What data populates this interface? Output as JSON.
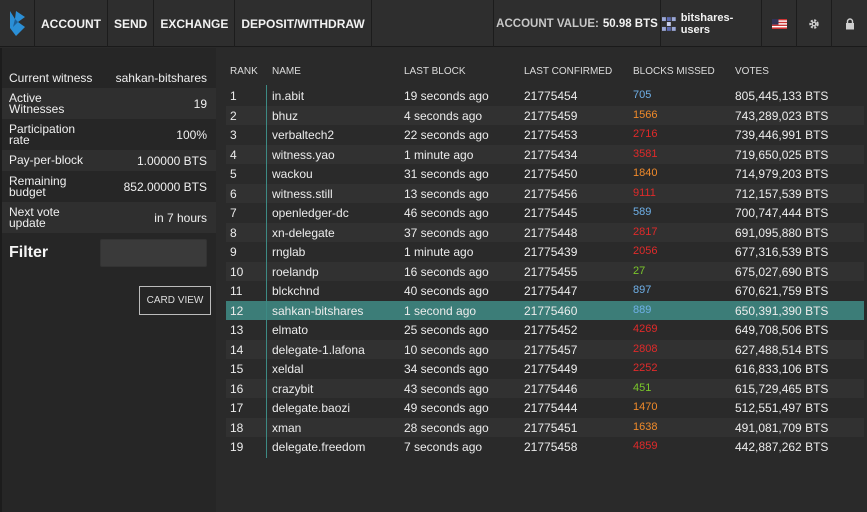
{
  "nav": {
    "items": [
      "ACCOUNT",
      "SEND",
      "EXCHANGE",
      "DEPOSIT/WITHDRAW"
    ],
    "account_value_label": "ACCOUNT VALUE:",
    "account_value": "50.98 BTS",
    "username": "bitshares-users"
  },
  "colors": {
    "accent": "#3c7d78",
    "brand": "#2b8fd6",
    "miss_blue": "#6fb0e8",
    "miss_orange": "#f08a2a",
    "miss_red": "#e02a2a",
    "miss_green": "#7ac72a"
  },
  "info": {
    "current_witness_label": "Current witness",
    "current_witness": "sahkan-bitshares",
    "active_witnesses_label": "Active Witnesses",
    "active_witnesses": "19",
    "participation_label": "Participation rate",
    "participation": "100%",
    "pay_per_block_label": "Pay-per-block",
    "pay_per_block": "1.00000 BTS",
    "remaining_budget_label": "Remaining budget",
    "remaining_budget": "852.00000 BTS",
    "next_vote_label": "Next vote update",
    "next_vote": "in 7 hours"
  },
  "filter": {
    "label": "Filter",
    "value": ""
  },
  "card_view_label": "CARD VIEW",
  "table": {
    "headers": [
      "RANK",
      "NAME",
      "LAST BLOCK",
      "LAST CONFIRMED",
      "BLOCKS MISSED",
      "VOTES"
    ],
    "rows": [
      {
        "rank": "1",
        "name": "in.abit",
        "last_block": "19 seconds ago",
        "confirmed": "21775454",
        "missed": "705",
        "missed_color": "#6fb0e8",
        "votes": "805,445,133 BTS"
      },
      {
        "rank": "2",
        "name": "bhuz",
        "last_block": "4 seconds ago",
        "confirmed": "21775459",
        "missed": "1566",
        "missed_color": "#f08a2a",
        "votes": "743,289,023 BTS"
      },
      {
        "rank": "3",
        "name": "verbaltech2",
        "last_block": "22 seconds ago",
        "confirmed": "21775453",
        "missed": "2716",
        "missed_color": "#e02a2a",
        "votes": "739,446,991 BTS"
      },
      {
        "rank": "4",
        "name": "witness.yao",
        "last_block": "1 minute ago",
        "confirmed": "21775434",
        "missed": "3581",
        "missed_color": "#e02a2a",
        "votes": "719,650,025 BTS"
      },
      {
        "rank": "5",
        "name": "wackou",
        "last_block": "31 seconds ago",
        "confirmed": "21775450",
        "missed": "1840",
        "missed_color": "#f08a2a",
        "votes": "714,979,203 BTS"
      },
      {
        "rank": "6",
        "name": "witness.still",
        "last_block": "13 seconds ago",
        "confirmed": "21775456",
        "missed": "9111",
        "missed_color": "#e02a2a",
        "votes": "712,157,539 BTS"
      },
      {
        "rank": "7",
        "name": "openledger-dc",
        "last_block": "46 seconds ago",
        "confirmed": "21775445",
        "missed": "589",
        "missed_color": "#6fb0e8",
        "votes": "700,747,444 BTS"
      },
      {
        "rank": "8",
        "name": "xn-delegate",
        "last_block": "37 seconds ago",
        "confirmed": "21775448",
        "missed": "2817",
        "missed_color": "#e02a2a",
        "votes": "691,095,880 BTS"
      },
      {
        "rank": "9",
        "name": "rnglab",
        "last_block": "1 minute ago",
        "confirmed": "21775439",
        "missed": "2056",
        "missed_color": "#e02a2a",
        "votes": "677,316,539 BTS"
      },
      {
        "rank": "10",
        "name": "roelandp",
        "last_block": "16 seconds ago",
        "confirmed": "21775455",
        "missed": "27",
        "missed_color": "#7ac72a",
        "votes": "675,027,690 BTS"
      },
      {
        "rank": "11",
        "name": "blckchnd",
        "last_block": "40 seconds ago",
        "confirmed": "21775447",
        "missed": "897",
        "missed_color": "#6fb0e8",
        "votes": "670,621,759 BTS"
      },
      {
        "rank": "12",
        "name": "sahkan-bitshares",
        "last_block": "1 second ago",
        "confirmed": "21775460",
        "missed": "889",
        "missed_color": "#6fb0e8",
        "votes": "650,391,390 BTS"
      },
      {
        "rank": "13",
        "name": "elmato",
        "last_block": "25 seconds ago",
        "confirmed": "21775452",
        "missed": "4269",
        "missed_color": "#e02a2a",
        "votes": "649,708,506 BTS"
      },
      {
        "rank": "14",
        "name": "delegate-1.lafona",
        "last_block": "10 seconds ago",
        "confirmed": "21775457",
        "missed": "2808",
        "missed_color": "#e02a2a",
        "votes": "627,488,514 BTS"
      },
      {
        "rank": "15",
        "name": "xeldal",
        "last_block": "34 seconds ago",
        "confirmed": "21775449",
        "missed": "2252",
        "missed_color": "#e02a2a",
        "votes": "616,833,106 BTS"
      },
      {
        "rank": "16",
        "name": "crazybit",
        "last_block": "43 seconds ago",
        "confirmed": "21775446",
        "missed": "451",
        "missed_color": "#7ac72a",
        "votes": "615,729,465 BTS"
      },
      {
        "rank": "17",
        "name": "delegate.baozi",
        "last_block": "49 seconds ago",
        "confirmed": "21775444",
        "missed": "1470",
        "missed_color": "#f08a2a",
        "votes": "512,551,497 BTS"
      },
      {
        "rank": "18",
        "name": "xman",
        "last_block": "28 seconds ago",
        "confirmed": "21775451",
        "missed": "1638",
        "missed_color": "#f08a2a",
        "votes": "491,081,709 BTS"
      },
      {
        "rank": "19",
        "name": "delegate.freedom",
        "last_block": "7 seconds ago",
        "confirmed": "21775458",
        "missed": "4859",
        "missed_color": "#e02a2a",
        "votes": "442,887,262 BTS"
      }
    ]
  }
}
